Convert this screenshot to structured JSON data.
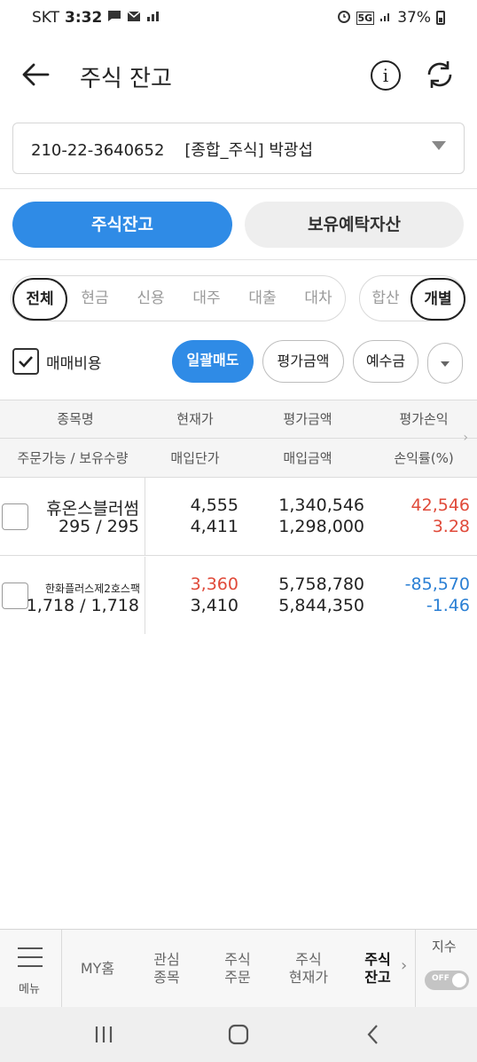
{
  "status_bar": {
    "carrier": "SKT",
    "time": "3:32",
    "network": "5G",
    "battery": "37%"
  },
  "header": {
    "title": "주식 잔고",
    "info_glyph": "i"
  },
  "account": {
    "number": "210-22-3640652",
    "type": "[종합_주식]",
    "owner": "박광섭"
  },
  "tabs": [
    {
      "label": "주식잔고",
      "active": true
    },
    {
      "label": "보유예탁자산",
      "active": false
    }
  ],
  "filters": [
    {
      "label": "전체",
      "active": true
    },
    {
      "label": "현금",
      "active": false
    },
    {
      "label": "신용",
      "active": false
    },
    {
      "label": "대주",
      "active": false
    },
    {
      "label": "대출",
      "active": false
    },
    {
      "label": "대차",
      "active": false
    }
  ],
  "view_modes": [
    {
      "label": "합산",
      "active": false
    },
    {
      "label": "개별",
      "active": true
    }
  ],
  "options": {
    "fee_checkbox_label": "매매비용",
    "fee_checked": true,
    "sell_all_label": "일괄매도",
    "eval_amount_label": "평가금액",
    "deposit_label": "예수금"
  },
  "table": {
    "headers_row1": [
      "종목명",
      "현재가",
      "평가금액",
      "평가손익"
    ],
    "headers_row2": [
      "주문가능 / 보유수량",
      "매입단가",
      "매입금액",
      "손익률(%)"
    ],
    "rows": [
      {
        "name": "휴온스블러썸",
        "qty": "295 / 295",
        "current_price": "4,555",
        "buy_price": "4,411",
        "eval_amount": "1,340,546",
        "buy_amount": "1,298,000",
        "profit": "42,546",
        "rate": "3.28"
      },
      {
        "name": "한화플러스제2호스팩",
        "qty": "1,718 / 1,718",
        "current_price": "3,360",
        "buy_price": "3,410",
        "eval_amount": "5,758,780",
        "buy_amount": "5,844,350",
        "profit": "-85,570",
        "rate": "-1.46"
      }
    ]
  },
  "bottom_nav": {
    "menu_label": "메뉴",
    "items": [
      {
        "label": "MY홈",
        "active": false
      },
      {
        "label": "관심\n종목",
        "active": false
      },
      {
        "label": "주식\n주문",
        "active": false
      },
      {
        "label": "주식\n현재가",
        "active": false
      },
      {
        "label": "주식\n잔고",
        "active": true
      }
    ],
    "index_label": "지수",
    "toggle_text": "OFF"
  },
  "colors": {
    "accent": "#2f8be6",
    "up": "#e04a3a",
    "down": "#2a7fd4"
  }
}
